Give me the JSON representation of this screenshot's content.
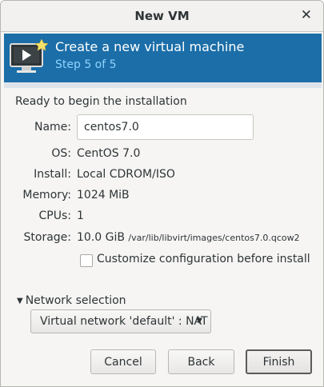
{
  "window": {
    "title": "New VM"
  },
  "banner": {
    "heading": "Create a new virtual machine",
    "step": "Step 5 of 5"
  },
  "summary": {
    "section_title": "Ready to begin the installation",
    "name_label": "Name:",
    "name_value": "centos7.0",
    "os_label": "OS:",
    "os_value": "CentOS 7.0",
    "install_label": "Install:",
    "install_value": "Local CDROM/ISO",
    "memory_label": "Memory:",
    "memory_value": "1024 MiB",
    "cpus_label": "CPUs:",
    "cpus_value": "1",
    "storage_label": "Storage:",
    "storage_size": "10.0 GiB",
    "storage_path": "/var/lib/libvirt/images/centos7.0.qcow2"
  },
  "customize": {
    "label": "Customize configuration before install",
    "checked": false
  },
  "network": {
    "expander_label": "Network selection",
    "selected": "Virtual network 'default' : NAT"
  },
  "buttons": {
    "cancel": "Cancel",
    "back": "Back",
    "finish": "Finish"
  },
  "icons": {
    "close": "close-icon",
    "vm": "new-vm-monitor-icon",
    "expander": "triangle-down-icon",
    "dropdown": "chevron-down-icon"
  },
  "colors": {
    "banner_bg": "#1b6ea8",
    "banner_step_text": "#8fd3ff"
  }
}
